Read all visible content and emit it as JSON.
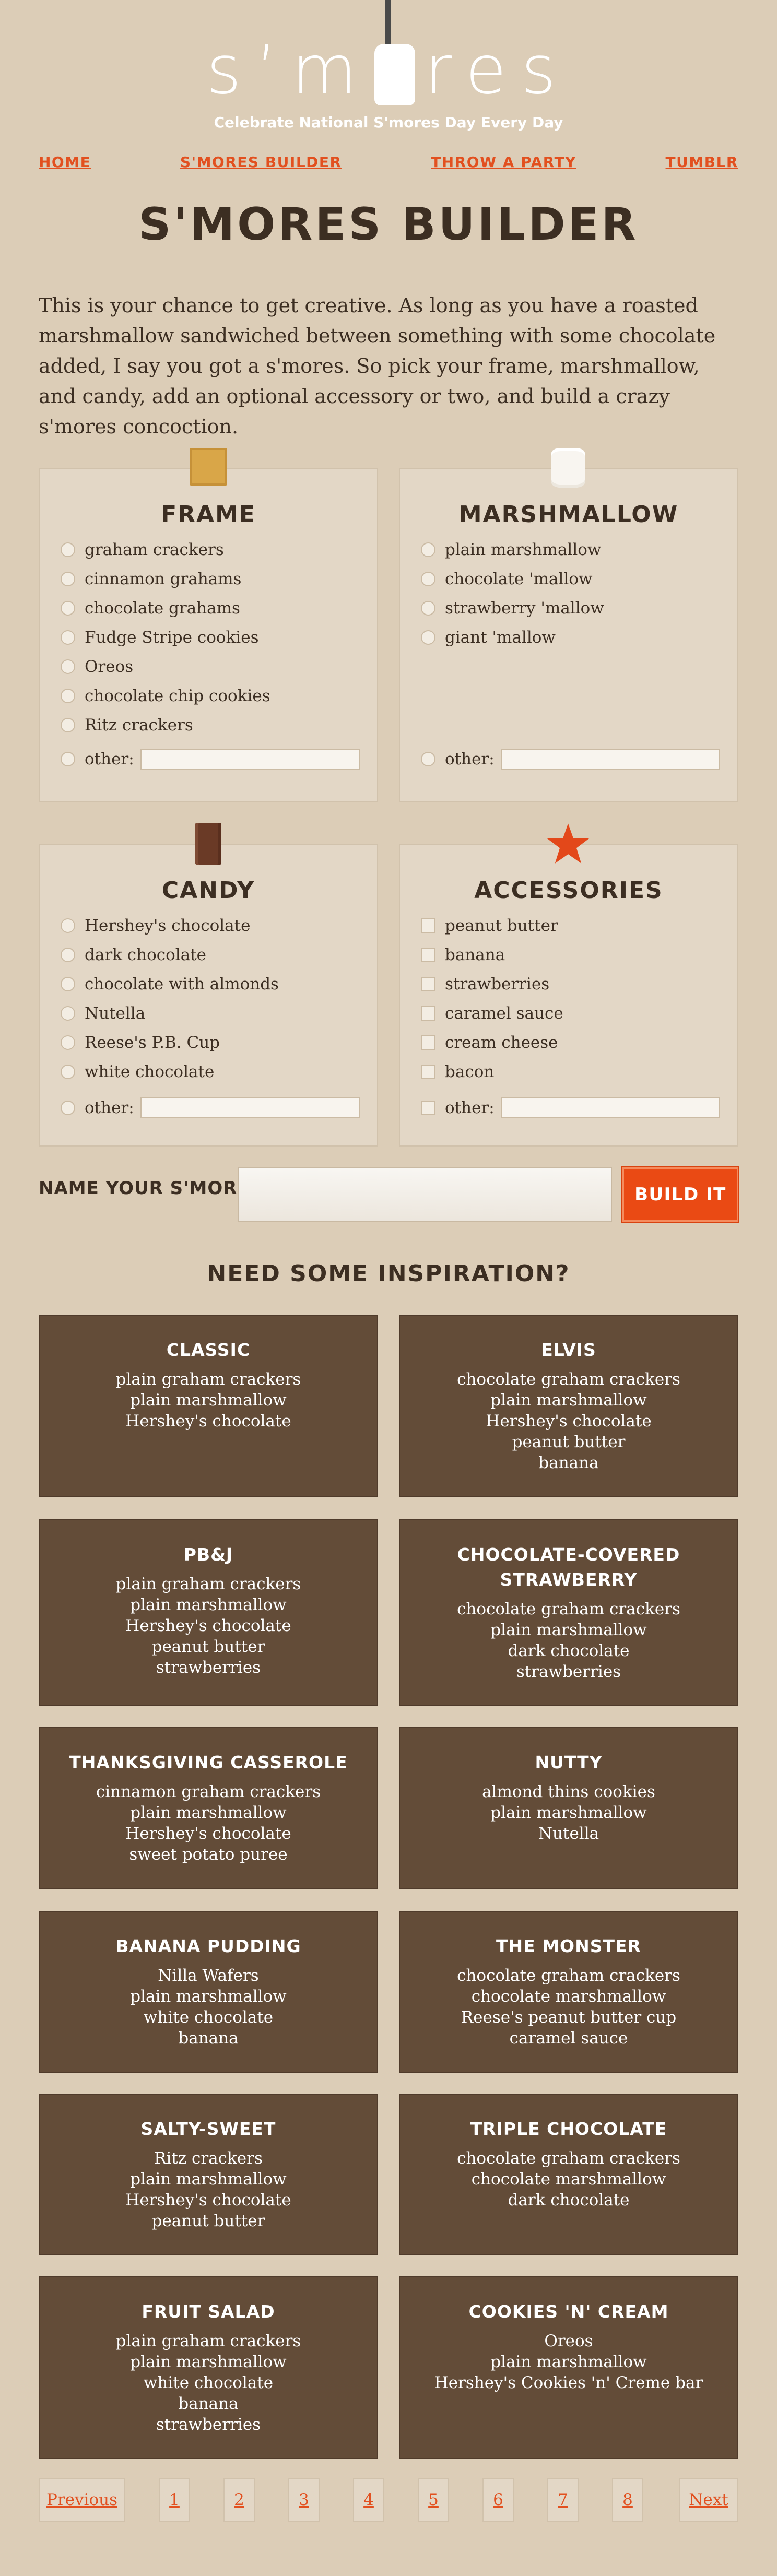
{
  "header": {
    "logo": "s’mores",
    "logo_left": "s’m",
    "logo_right": "res",
    "tagline": "Celebrate National S'mores Day Every Day"
  },
  "nav": [
    "HOME",
    "S'MORES BUILDER",
    "THROW A PARTY",
    "TUMBLR"
  ],
  "page_title": "S'MORES BUILDER",
  "intro": "This is your chance to get creative. As long as you have a roasted marshmallow sandwiched between something with some chocolate added, I say you got a s'mores. So pick your frame, marshmallow, and candy, add an optional accessory or two, and build a crazy s'mores concoction.",
  "builder": {
    "frame": {
      "title": "FRAME",
      "options": [
        "graham crackers",
        "cinnamon grahams",
        "chocolate grahams",
        "Fudge Stripe cookies",
        "Oreos",
        "chocolate chip cookies",
        "Ritz crackers"
      ],
      "other_label": "other:"
    },
    "marshmallow": {
      "title": "MARSHMALLOW",
      "options": [
        "plain marshmallow",
        "chocolate 'mallow",
        "strawberry 'mallow",
        "giant 'mallow"
      ],
      "other_label": "other:"
    },
    "candy": {
      "title": "CANDY",
      "options": [
        "Hershey's chocolate",
        "dark chocolate",
        "chocolate with almonds",
        "Nutella",
        "Reese's P.B. Cup",
        "white chocolate"
      ],
      "other_label": "other:"
    },
    "accessories": {
      "title": "ACCESSORIES",
      "options": [
        "peanut butter",
        "banana",
        "strawberries",
        "caramel sauce",
        "cream cheese",
        "bacon"
      ],
      "other_label": "other:"
    },
    "name_label": "NAME YOUR S'MORES:",
    "name_value": "",
    "build_label": "BUILD IT"
  },
  "inspiration": {
    "title": "NEED SOME INSPIRATION?",
    "cards": [
      {
        "title": "CLASSIC",
        "items": [
          "plain graham crackers",
          "plain marshmallow",
          "Hershey's chocolate"
        ]
      },
      {
        "title": "ELVIS",
        "items": [
          "chocolate graham crackers",
          "plain marshmallow",
          "Hershey's chocolate",
          "peanut butter",
          "banana"
        ]
      },
      {
        "title": "PB&J",
        "items": [
          "plain graham crackers",
          "plain marshmallow",
          "Hershey's chocolate",
          "peanut butter",
          "strawberries"
        ]
      },
      {
        "title": "CHOCOLATE-COVERED STRAWBERRY",
        "items": [
          "chocolate graham crackers",
          "plain marshmallow",
          "dark chocolate",
          "strawberries"
        ]
      },
      {
        "title": "THANKSGIVING CASSEROLE",
        "items": [
          "cinnamon graham crackers",
          "plain marshmallow",
          "Hershey's chocolate",
          "sweet potato puree"
        ]
      },
      {
        "title": "NUTTY",
        "items": [
          "almond thins cookies",
          "plain marshmallow",
          "Nutella"
        ]
      },
      {
        "title": "BANANA PUDDING",
        "items": [
          "Nilla Wafers",
          "plain marshmallow",
          "white chocolate",
          "banana"
        ]
      },
      {
        "title": "THE MONSTER",
        "items": [
          "chocolate graham crackers",
          "chocolate marshmallow",
          "Reese's peanut butter cup",
          "caramel sauce"
        ]
      },
      {
        "title": "SALTY-SWEET",
        "items": [
          "Ritz crackers",
          "plain marshmallow",
          "Hershey's chocolate",
          "peanut butter"
        ]
      },
      {
        "title": "TRIPLE CHOCOLATE",
        "items": [
          "chocolate graham crackers",
          "chocolate marshmallow",
          "dark chocolate"
        ]
      },
      {
        "title": "FRUIT SALAD",
        "items": [
          "plain graham crackers",
          "plain marshmallow",
          "white chocolate",
          "banana",
          "strawberries"
        ]
      },
      {
        "title": "COOKIES 'N' CREAM",
        "items": [
          "Oreos",
          "plain marshmallow",
          "Hershey's Cookies 'n' Creme bar"
        ]
      }
    ]
  },
  "pagination": {
    "previous": "Previous",
    "pages": [
      "1",
      "2",
      "3",
      "4",
      "5",
      "6",
      "7",
      "8"
    ],
    "next": "Next"
  },
  "colors": {
    "background": "#dccdb7",
    "accent": "#e2501f",
    "card": "#634c38",
    "panel": "#e3d7c6"
  }
}
